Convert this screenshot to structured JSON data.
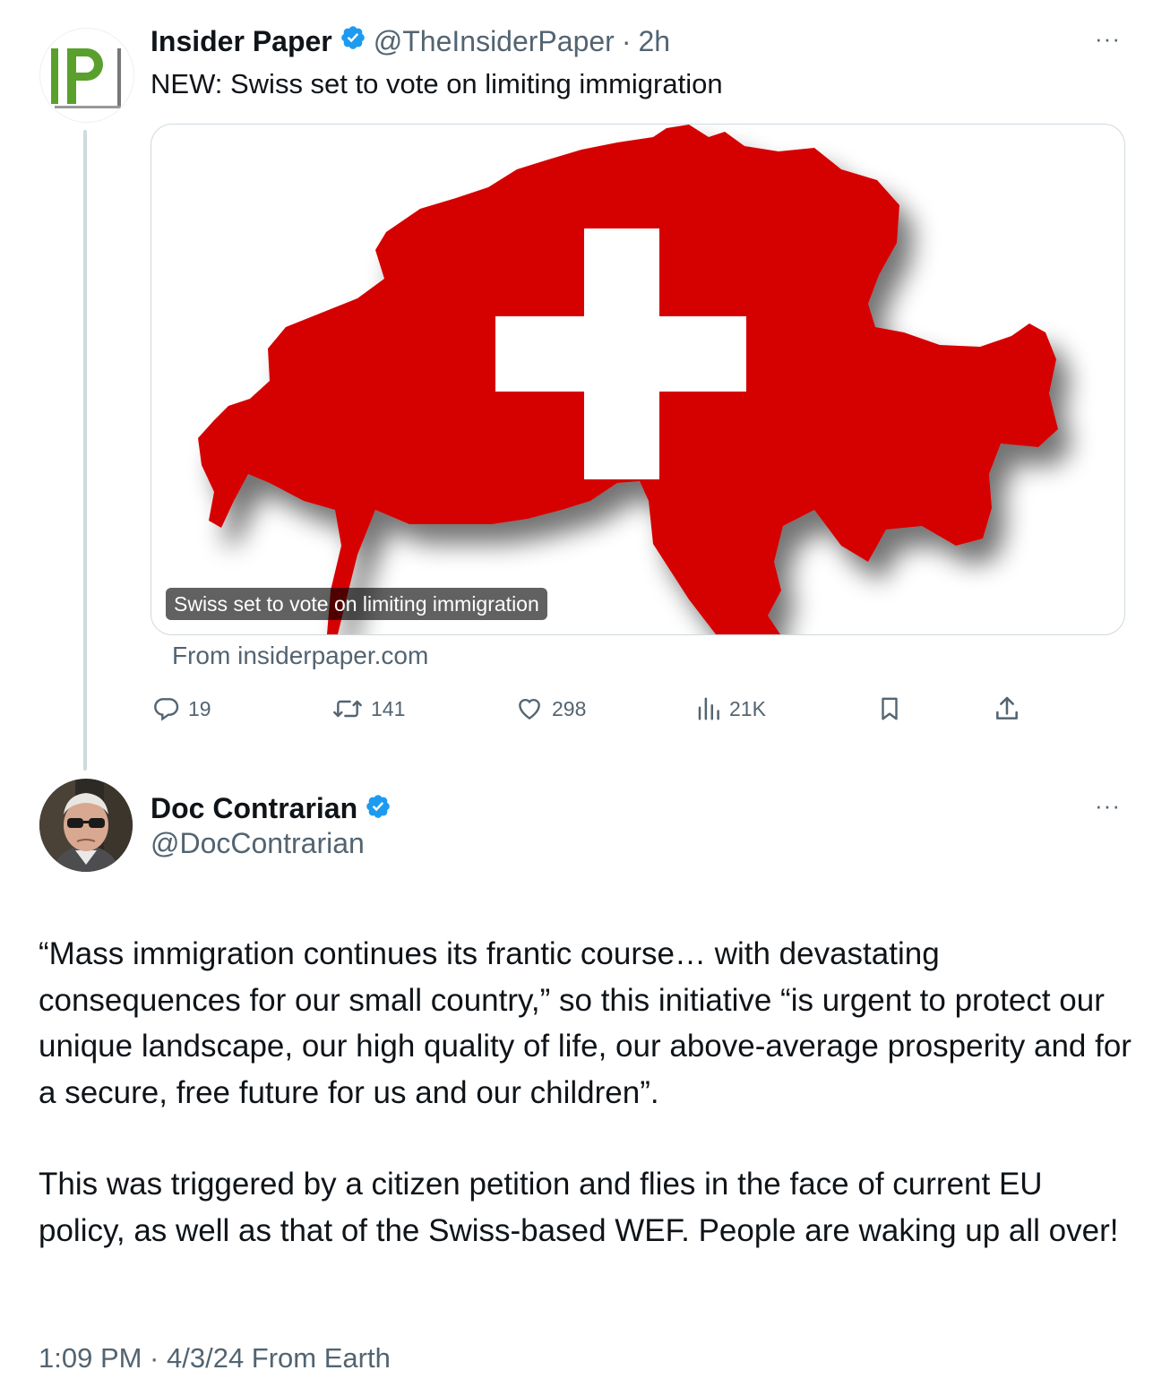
{
  "quoted_tweet": {
    "author_name": "Insider Paper",
    "handle": "@TheInsiderPaper",
    "separator": "·",
    "time_ago": "2h",
    "avatar_text": "IP",
    "text": "NEW: Swiss set to vote on limiting immigration",
    "card": {
      "image_caption": "Swiss set to vote on limiting immigration",
      "source": "From insiderpaper.com"
    },
    "actions": {
      "replies": "19",
      "retweets": "141",
      "likes": "298",
      "views": "21K"
    },
    "more_label": "···"
  },
  "reply_tweet": {
    "author_name": "Doc Contrarian",
    "handle": "@DocContrarian",
    "more_label": "···",
    "paragraphs": [
      "“Mass immigration continues its frantic course… with devastating consequences for our small country,” so this initiative “is urgent to protect our unique landscape, our high quality of life, our above-average prosperity and for a secure, free future for us and our children”.",
      "This was triggered by a citizen petition and flies in the face of current EU policy, as well as that of the Swiss-based WEF. People are waking up all over!"
    ],
    "footer": "1:09 PM · 4/3/24 From Earth"
  },
  "colors": {
    "verified": "#1d9bf0",
    "flag_red": "#d50000",
    "muted": "#536471",
    "logo_green": "#5aa02c"
  },
  "icons": [
    "verified-badge-icon",
    "more-icon",
    "reply-icon",
    "retweet-icon",
    "like-icon",
    "views-icon",
    "bookmark-icon",
    "share-icon"
  ]
}
